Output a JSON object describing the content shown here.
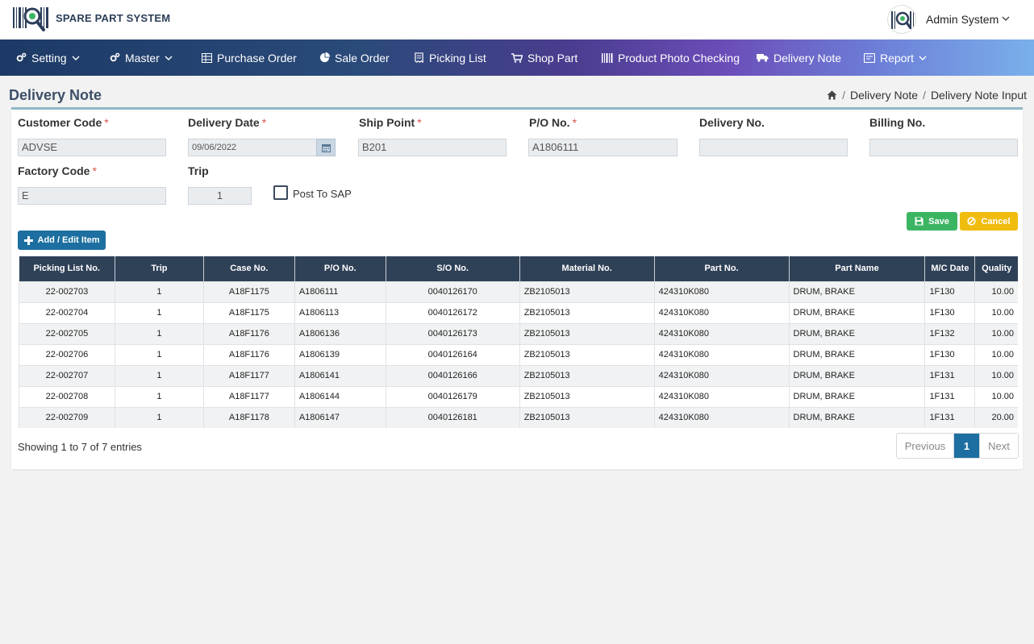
{
  "app": {
    "brand": "SPARE PART SYSTEM"
  },
  "user": {
    "name": "Admin System"
  },
  "nav": {
    "setting": "Setting",
    "master": "Master",
    "purchase_order": "Purchase Order",
    "sale_order": "Sale Order",
    "picking_list": "Picking List",
    "shop_part": "Shop Part",
    "product_photo_checking": "Product Photo Checking",
    "delivery_note": "Delivery Note",
    "report": "Report"
  },
  "page": {
    "title": "Delivery Note",
    "breadcrumb": [
      "Delivery Note",
      "Delivery Note Input"
    ]
  },
  "form": {
    "customer_code": {
      "label": "Customer Code",
      "value": "ADVSE",
      "required": "*"
    },
    "delivery_date": {
      "label": "Delivery Date",
      "value": "09/06/2022",
      "required": "*"
    },
    "ship_point": {
      "label": "Ship Point",
      "value": "B201",
      "required": "*"
    },
    "po_no": {
      "label": "P/O No.",
      "value": "A1806111",
      "required": "*"
    },
    "delivery_no": {
      "label": "Delivery No.",
      "value": ""
    },
    "billing_no": {
      "label": "Billing No.",
      "value": ""
    },
    "factory_code": {
      "label": "Factory Code",
      "value": "E",
      "required": "*"
    },
    "trip": {
      "label": "Trip",
      "value": "1"
    },
    "post_to_sap": {
      "label": "Post To SAP",
      "checked": false
    }
  },
  "buttons": {
    "save": "Save",
    "cancel": "Cancel",
    "add_edit": "Add / Edit Item"
  },
  "table": {
    "headers": [
      "Picking List No.",
      "Trip",
      "Case No.",
      "P/O No.",
      "S/O No.",
      "Material No.",
      "Part No.",
      "Part Name",
      "M/C Date",
      "Quality"
    ],
    "rows": [
      [
        "22-002703",
        "1",
        "A18F1175",
        "A1806111",
        "0040126170",
        "ZB2105013",
        "424310K080",
        "DRUM, BRAKE",
        "1F130",
        "10.00"
      ],
      [
        "22-002704",
        "1",
        "A18F1175",
        "A1806113",
        "0040126172",
        "ZB2105013",
        "424310K080",
        "DRUM, BRAKE",
        "1F130",
        "10.00"
      ],
      [
        "22-002705",
        "1",
        "A18F1176",
        "A1806136",
        "0040126173",
        "ZB2105013",
        "424310K080",
        "DRUM, BRAKE",
        "1F132",
        "10.00"
      ],
      [
        "22-002706",
        "1",
        "A18F1176",
        "A1806139",
        "0040126164",
        "ZB2105013",
        "424310K080",
        "DRUM, BRAKE",
        "1F130",
        "10.00"
      ],
      [
        "22-002707",
        "1",
        "A18F1177",
        "A1806141",
        "0040126166",
        "ZB2105013",
        "424310K080",
        "DRUM, BRAKE",
        "1F131",
        "10.00"
      ],
      [
        "22-002708",
        "1",
        "A18F1177",
        "A1806144",
        "0040126179",
        "ZB2105013",
        "424310K080",
        "DRUM, BRAKE",
        "1F131",
        "10.00"
      ],
      [
        "22-002709",
        "1",
        "A18F1178",
        "A1806147",
        "0040126181",
        "ZB2105013",
        "424310K080",
        "DRUM, BRAKE",
        "1F131",
        "20.00"
      ]
    ]
  },
  "pagination": {
    "info": "Showing 1 to 7 of 7 entries",
    "previous": "Previous",
    "current": "1",
    "next": "Next"
  }
}
